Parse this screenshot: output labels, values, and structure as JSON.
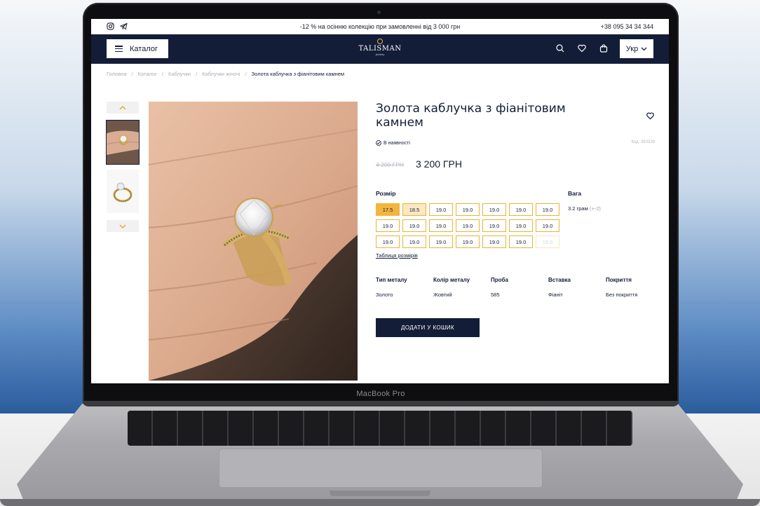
{
  "topbar": {
    "promo": "-12 % на осінню колекцію при замовленні від 3 000 грн",
    "phone": "+38 095 34 34 344",
    "social_icons": [
      "instagram-icon",
      "telegram-icon"
    ]
  },
  "nav": {
    "catalog_label": "Каталог",
    "logo_text": "TALISMAN",
    "logo_sub": "jewelry",
    "lang_label": "Укр",
    "icons": [
      "search-icon",
      "heart-icon",
      "bag-icon"
    ]
  },
  "breadcrumb": [
    "Головна",
    "/",
    "Каталог",
    "/",
    "Каблучки",
    "/",
    "Каблучки жіночі",
    "/",
    "Золота каблучка з фіанітовим камнем"
  ],
  "product": {
    "title": "Золота каблучка з фіанітовим камнем",
    "stock": "В наявності",
    "code": "Код: 393339",
    "old_price": "4 200 ГРН",
    "price": "3 200 ГРН",
    "size_label": "Розмір",
    "sizes": [
      "17.5",
      "18.5",
      "19.0",
      "19.0",
      "19.0",
      "19.0",
      "19.0",
      "19.0",
      "19.0",
      "19.0",
      "19.0",
      "19.0",
      "19.0",
      "19.0",
      "19.0",
      "19.0",
      "19.0",
      "19.0",
      "19.0",
      "19.0",
      "19.0"
    ],
    "size_table": "Таблиця розмірів",
    "weight_label": "Вага",
    "weight_value": "3.2 грам",
    "weight_tolerance": "(+-2)",
    "specs": [
      {
        "label": "Тип металу",
        "value": "Золото"
      },
      {
        "label": "Колір металу",
        "value": "Жовтий"
      },
      {
        "label": "Проба",
        "value": "585"
      },
      {
        "label": "Вставка",
        "value": "Фіаніт"
      },
      {
        "label": "Покриття",
        "value": "Без покриття"
      }
    ],
    "add_to_cart": "ДОДАТИ У КОШИК"
  },
  "device": {
    "label": "MacBook Pro"
  },
  "colors": {
    "navy": "#141d38",
    "gold": "#f3b53d"
  }
}
